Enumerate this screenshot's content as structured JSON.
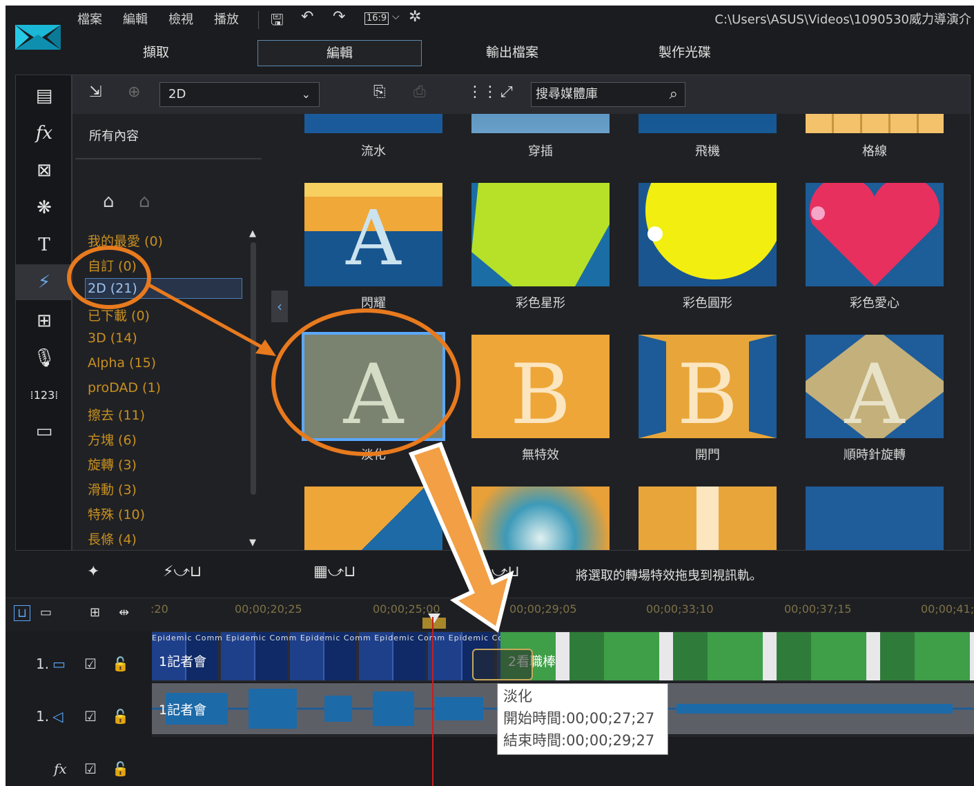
{
  "menu": [
    "檔案",
    "編輯",
    "檢視",
    "播放"
  ],
  "toolbar_icons": [
    "save-icon",
    "undo-icon",
    "redo-icon",
    "aspect-ratio-icon",
    "settings-icon"
  ],
  "aspect_label": "16:9",
  "project_path": "C:\\Users\\ASUS\\Videos\\1090530威力導演介",
  "main_tabs": [
    "擷取",
    "編輯",
    "輸出檔案",
    "製作光碟"
  ],
  "library": {
    "filter_value": "2D",
    "search_placeholder": "搜尋媒體庫",
    "all_content": "所有內容",
    "categories": [
      "我的最愛 (0)",
      "自訂 (0)",
      "2D (21)",
      "已下載 (0)",
      "3D (14)",
      "Alpha (15)",
      "proDAD (1)",
      "擦去 (11)",
      "方塊 (6)",
      "旋轉 (3)",
      "滑動 (3)",
      "特殊 (10)",
      "長條 (4)"
    ],
    "selected_category": "2D (21)",
    "transitions_row1": [
      "流水",
      "穿插",
      "飛機",
      "格線"
    ],
    "transitions_row2": [
      "閃耀",
      "彩色星形",
      "彩色圓形",
      "彩色愛心"
    ],
    "transitions_row3": [
      "淡化",
      "無特效",
      "開門",
      "順時針旋轉"
    ],
    "selected_transition": "淡化"
  },
  "hint": "將選取的轉場特效拖曳到視訊軌。",
  "ruler_times": [
    ":20",
    "00;00;20;25",
    "00;00;25;00",
    "00;00;29;05",
    "00;00;33;10",
    "00;00;37;15",
    "00;00;41;"
  ],
  "tracks": {
    "video_label": "1.",
    "audio_label": "1.",
    "clip1": "1記者會",
    "clip2": "2看職棒",
    "audio_clip": "1記者會",
    "clip_text": "Epidemic Comm"
  },
  "tooltip": {
    "name": "淡化",
    "start": "開始時間:00;00;27;27",
    "end": "結束時間:00;00;29;27"
  },
  "colors": {
    "accent_orange": "#e87a1e",
    "category_gold": "#c89020",
    "selection_blue": "#5aa8ff",
    "app_bg": "#1b1c1f"
  }
}
